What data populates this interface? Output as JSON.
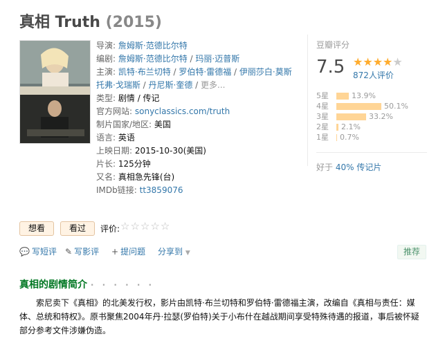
{
  "movie": {
    "title": "真相 Truth",
    "year": "(2015)"
  },
  "info": {
    "director_label": "导演",
    "director": "詹姆斯·范德比尔特",
    "writers_label": "编剧",
    "writers": [
      "詹姆斯·范德比尔特",
      "玛丽·迈普斯"
    ],
    "cast_label": "主演",
    "cast": [
      "凯特·布兰切特",
      "罗伯特·雷德福",
      "伊丽莎白·莫斯",
      "托弗·戈瑞斯",
      "丹尼斯·奎德"
    ],
    "cast_more": "更多...",
    "genre_label": "类型:",
    "genre": "剧情 / 传记",
    "website_label": "官方网站:",
    "website": "sonyclassics.com/truth",
    "country_label": "制片国家/地区:",
    "country": "美国",
    "language_label": "语言:",
    "language": "英语",
    "release_label": "上映日期:",
    "release": "2015-10-30(美国)",
    "runtime_label": "片长:",
    "runtime": "125分钟",
    "aka_label": "又名:",
    "aka": "真相急先锋(台)",
    "imdb_label": "IMDb链接:",
    "imdb": "tt3859076"
  },
  "rating": {
    "label": "豆瓣评分",
    "score": "7.5",
    "stars_value": 4,
    "votes": "872人评价",
    "distribution": [
      {
        "star": "5星",
        "pct": "13.9%",
        "value": 13.9
      },
      {
        "star": "4星",
        "pct": "50.1%",
        "value": 50.1
      },
      {
        "star": "3星",
        "pct": "33.2%",
        "value": 33.2
      },
      {
        "star": "2星",
        "pct": "2.1%",
        "value": 2.1
      },
      {
        "star": "1星",
        "pct": "0.7%",
        "value": 0.7
      }
    ],
    "better_prefix": "好于 ",
    "better_link": "40% 传记片"
  },
  "actions": {
    "want": "想看",
    "seen": "看过",
    "rate_label": "评价:",
    "write_short": "写短评",
    "write_review": "写影评",
    "ask": "提问题",
    "share": "分享到",
    "recommend": "推荐"
  },
  "summary": {
    "title": "真相的剧情简介",
    "dots": "· · · · · ·",
    "text": "索尼卖下《真相》的北美发行权，影片由凯特·布兰切特和罗伯特·雷德福主演，改编自《真相与责任：媒体、总统和特权》。原书聚焦2004年丹·拉瑟(罗伯特)关于小布什在越战期间享受特殊待遇的报道，事后被怀疑部分参考文件涉嫌伪造。"
  },
  "colors": {
    "link": "#3377aa",
    "star": "#ffac2d",
    "bar": "#ffd596",
    "section_title": "#007722"
  }
}
